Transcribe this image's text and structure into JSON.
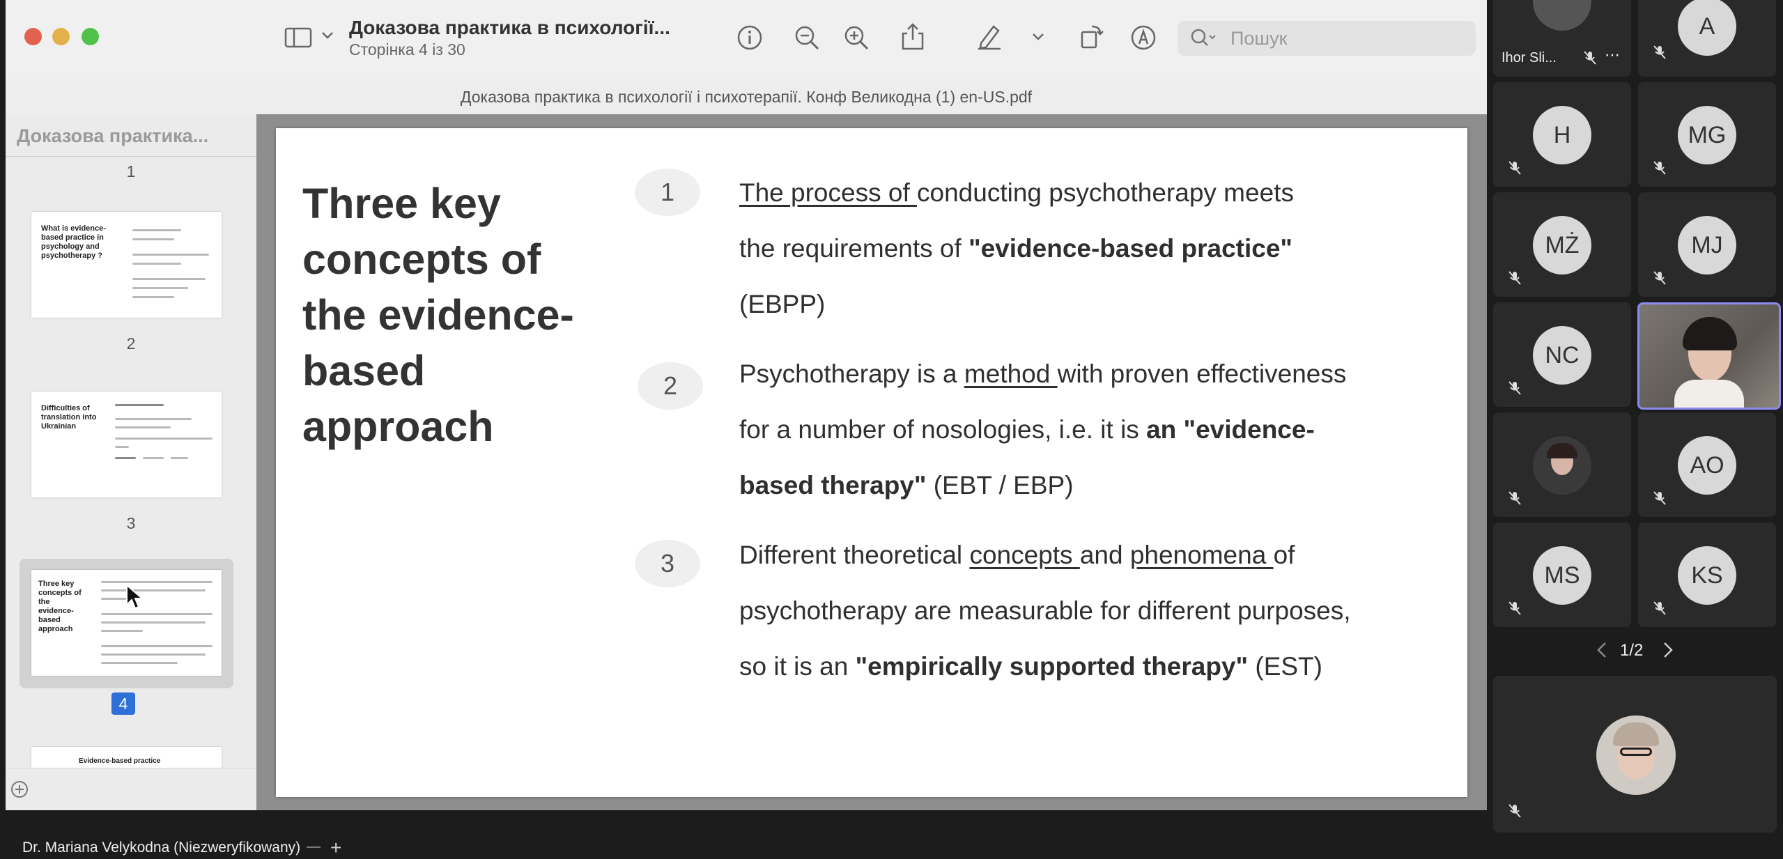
{
  "viewer": {
    "doc_title": "Доказова практика в психології...",
    "page_status": "Сторінка 4 із 30",
    "search_placeholder": "Пошук",
    "file_name": "Доказова практика в психології і психотерапії. Конф Великодна (1) en-US.pdf",
    "sidebar_title": "Доказова практика...",
    "thumbnails": [
      {
        "page": "1",
        "title": "What is evidence-based practice in psychology and psychotherapy ?"
      },
      {
        "page": "2",
        "title": "Difficulties of translation into Ukrainian"
      },
      {
        "page": "3",
        "title": "Three key concepts of the evidence-based approach"
      },
      {
        "page": "4",
        "title": "Evidence-based practice"
      }
    ],
    "selected_page": "4"
  },
  "slide": {
    "title": "Three key concepts of the evidence-based approach",
    "items": [
      {
        "number": "1",
        "line1_underlined": "The process of ",
        "line1_rest": "conducting psychotherapy meets",
        "line2_pre": "the requirements of ",
        "line2_bold": "\"evidence-based practice\"",
        "line3": "(EBPP)"
      },
      {
        "number": "2",
        "line1_pre": "Psychotherapy is a ",
        "line1_underlined": "method ",
        "line1_rest": "with proven effectiveness",
        "line2_pre": "for a number of nosologies, i.e. it is ",
        "line2_bold": "an \"evidence-",
        "line3_bold": "based therapy\"",
        "line3_rest": " (EBT / EBP)"
      },
      {
        "number": "3",
        "line1_pre": "Different theoretical ",
        "line1_u1": "concepts ",
        "line1_mid": "and ",
        "line1_u2": "phenomena ",
        "line1_rest": "of",
        "line2": "psychotherapy are measurable for different purposes,",
        "line3_pre": "so it is an ",
        "line3_bold": "\"empirically supported therapy\"",
        "line3_rest": " (EST)"
      }
    ]
  },
  "meeting": {
    "participants": [
      {
        "label": "Ihor Sli...",
        "avatar": "photo"
      },
      {
        "label": "",
        "avatar": "A"
      },
      {
        "label": "",
        "avatar": "H"
      },
      {
        "label": "",
        "avatar": "MG"
      },
      {
        "label": "",
        "avatar": "MŻ"
      },
      {
        "label": "",
        "avatar": "MJ"
      },
      {
        "label": "",
        "avatar": "NC"
      },
      {
        "label": "",
        "avatar": "video"
      },
      {
        "label": "",
        "avatar": "photo"
      },
      {
        "label": "",
        "avatar": "AO"
      },
      {
        "label": "",
        "avatar": "MS"
      },
      {
        "label": "",
        "avatar": "KS"
      }
    ],
    "pagination": "1/2",
    "presenter_name": "Dr. Mariana Velykodna (Niezweryfikowany)",
    "colors": {
      "active_border": "#8a8cf0",
      "panel_bg": "#1c1c1c",
      "tile_bg": "#2a2a2a"
    }
  }
}
